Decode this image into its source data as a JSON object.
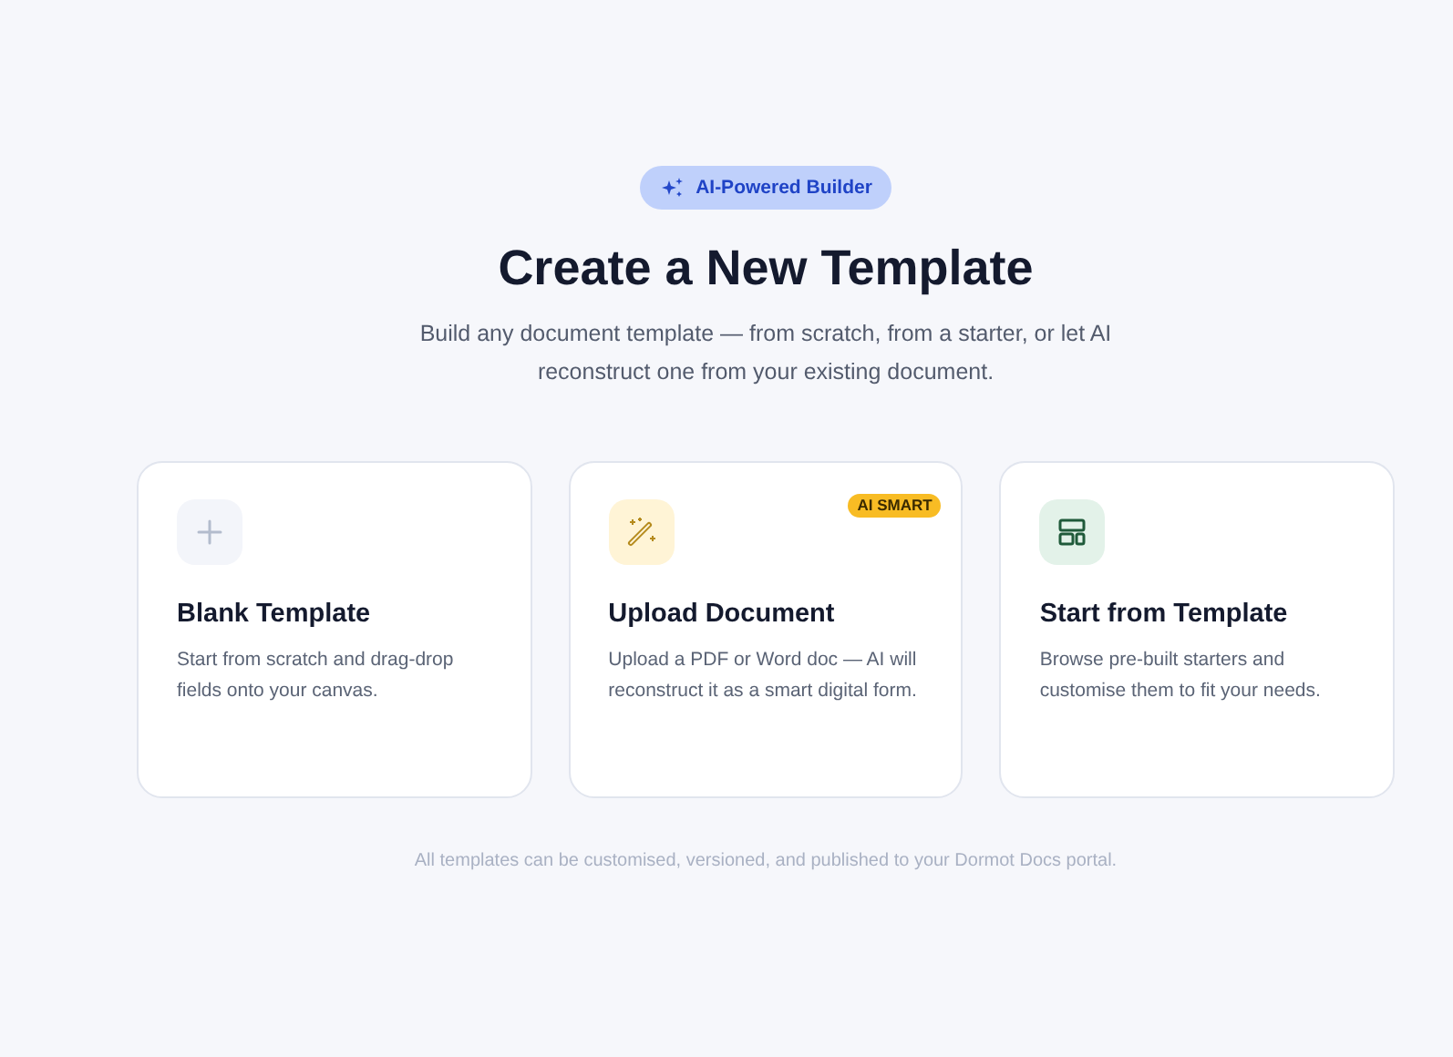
{
  "badge": {
    "label": "AI-Powered Builder"
  },
  "title": "Create a New Template",
  "subtitle": "Build any document template — from scratch, from a starter, or let AI reconstruct one from your existing document.",
  "cards": [
    {
      "kind": "plus",
      "title": "Blank Template",
      "description": "Start from scratch and drag-drop fields onto your canvas."
    },
    {
      "kind": "wand",
      "title": "Upload Document",
      "description": "Upload a PDF or Word doc — AI will reconstruct it as a smart digital form.",
      "badge": "AI SMART"
    },
    {
      "kind": "layout",
      "title": "Start from Template",
      "description": "Browse pre-built starters and customise them to fit your needs."
    }
  ],
  "footer": "All templates can be customised, versioned, and published to your Dormot Docs portal."
}
